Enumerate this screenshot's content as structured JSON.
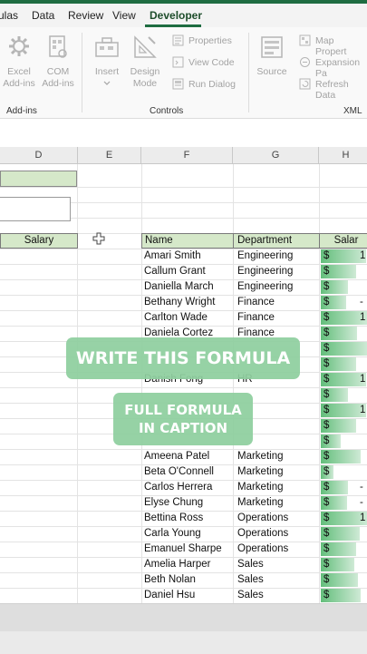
{
  "menu": {
    "items": [
      "ulas",
      "Data",
      "Review",
      "View",
      "Developer"
    ],
    "active": "Developer"
  },
  "ribbon": {
    "excel_addins": "Excel\nAdd-ins",
    "com_addins": "COM\nAdd-ins",
    "insert": "Insert",
    "design_mode": "Design\nMode",
    "properties": "Properties",
    "view_code": "View Code",
    "run_dialog": "Run Dialog",
    "source": "Source",
    "map_properties": "Map Propert",
    "expansion_packs": "Expansion Pa",
    "refresh_data": "Refresh Data",
    "group_addins": "Add-ins",
    "group_controls": "Controls",
    "group_xml": "XML"
  },
  "sheet": {
    "columns": [
      "D",
      "E",
      "F",
      "G",
      "H"
    ],
    "left_header": "Salary",
    "headers": {
      "name": "Name",
      "department": "Department",
      "salary": "Salar"
    },
    "currency": "$",
    "rows": [
      {
        "name": "Amari Smith",
        "department": "Engineering",
        "salary": 0.9,
        "suffix": "1"
      },
      {
        "name": "Callum Grant",
        "department": "Engineering",
        "salary": 0.7,
        "suffix": ""
      },
      {
        "name": "Daniella March",
        "department": "Engineering",
        "salary": 0.55,
        "suffix": ""
      },
      {
        "name": "Bethany Wright",
        "department": "Finance",
        "salary": 0.5,
        "suffix": "-"
      },
      {
        "name": "Carlton Wade",
        "department": "Finance",
        "salary": 0.92,
        "suffix": "1"
      },
      {
        "name": "Daniela Cortez",
        "department": "Finance",
        "salary": 0.72,
        "suffix": ""
      },
      {
        "name": "",
        "department": "",
        "salary": 0.95,
        "suffix": ""
      },
      {
        "name": "",
        "department": "",
        "salary": 0.7,
        "suffix": ""
      },
      {
        "name": "Danish Fong",
        "department": "HR",
        "salary": 0.9,
        "suffix": "1"
      },
      {
        "name": "",
        "department": "",
        "salary": 0.55,
        "suffix": ""
      },
      {
        "name": "",
        "department": "",
        "salary": 0.9,
        "suffix": "1"
      },
      {
        "name": "",
        "department": "",
        "salary": 0.7,
        "suffix": ""
      },
      {
        "name": "",
        "department": "",
        "salary": 0.4,
        "suffix": ""
      },
      {
        "name": "Ameena Patel",
        "department": "Marketing",
        "salary": 0.8,
        "suffix": ""
      },
      {
        "name": "Beta O'Connell",
        "department": "Marketing",
        "salary": 0.25,
        "suffix": ""
      },
      {
        "name": "Carlos Herrera",
        "department": "Marketing",
        "salary": 0.55,
        "suffix": "-"
      },
      {
        "name": "Elyse Chung",
        "department": "Marketing",
        "salary": 0.52,
        "suffix": "-"
      },
      {
        "name": "Bettina Ross",
        "department": "Operations",
        "salary": 0.95,
        "suffix": "1"
      },
      {
        "name": "Carla Young",
        "department": "Operations",
        "salary": 0.78,
        "suffix": ""
      },
      {
        "name": "Emanuel Sharpe",
        "department": "Operations",
        "salary": 0.7,
        "suffix": ""
      },
      {
        "name": "Amelia Harper",
        "department": "Sales",
        "salary": 0.68,
        "suffix": ""
      },
      {
        "name": "Beth Nolan",
        "department": "Sales",
        "salary": 0.75,
        "suffix": ""
      },
      {
        "name": "Daniel Hsu",
        "department": "Sales",
        "salary": 0.8,
        "suffix": ""
      }
    ]
  },
  "overlay": {
    "headline": "WRITE THIS FORMULA",
    "sub_line1": "FULL FORMULA",
    "sub_line2": "IN CAPTION"
  }
}
